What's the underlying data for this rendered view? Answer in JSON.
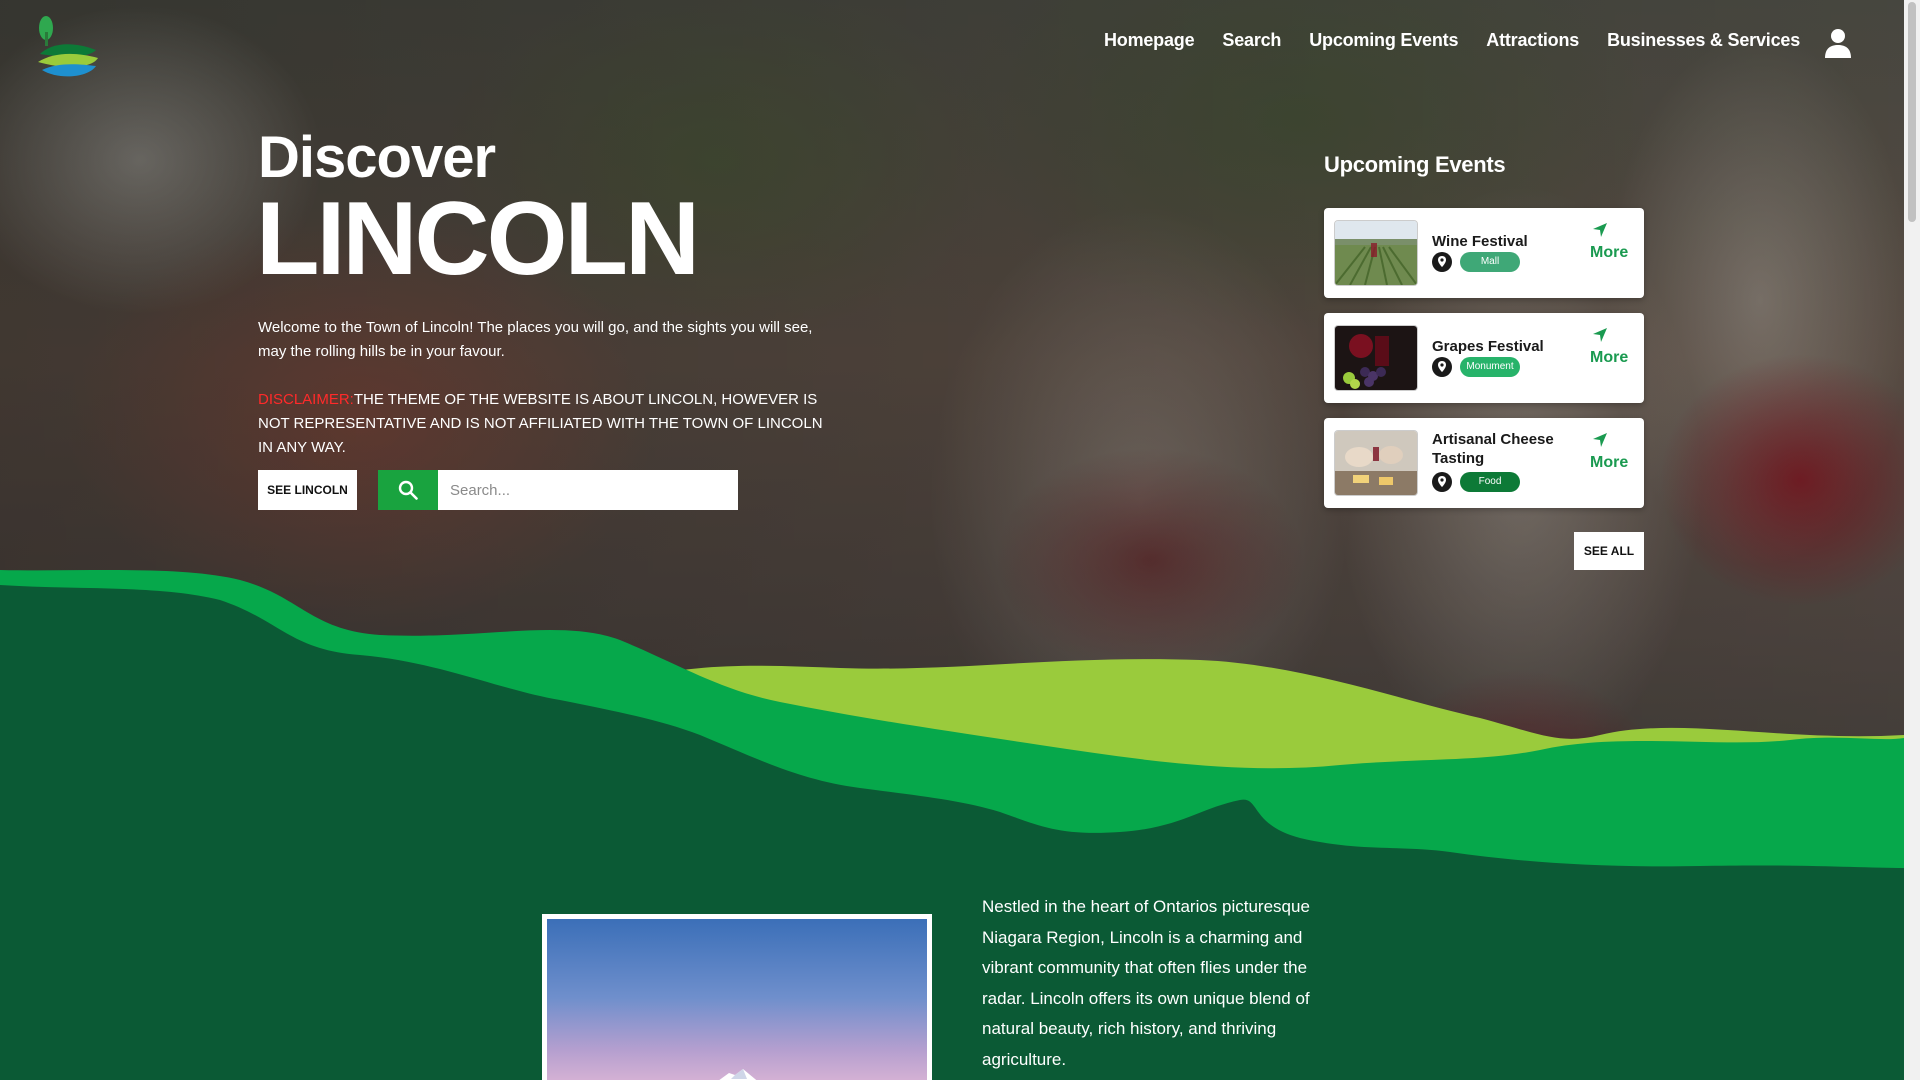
{
  "colors": {
    "dark_green": "#0b5a35",
    "mid_green": "#06a84b",
    "light_green": "#9acb3c",
    "accent_green": "#19a33f",
    "disclaimer_red": "#ff2a2a"
  },
  "header": {
    "logo_icon": "lincoln-hills-logo",
    "nav": [
      "Homepage",
      "Search",
      "Upcoming Events",
      "Attractions",
      "Businesses & Services"
    ],
    "account_icon": "user-icon"
  },
  "hero": {
    "discover": "Discover",
    "title": "LINCOLN",
    "welcome": "Welcome to the Town of Lincoln! The places you will go, and the sights you will see, may the rolling hills be in your favour.",
    "disclaimer_label": "DISCLAIMER:",
    "disclaimer_text": "THE THEME OF THE WEBSITE IS ABOUT LINCOLN, HOWEVER IS NOT REPRESENTATIVE AND IS NOT AFFILIATED WITH THE TOWN OF LINCOLN IN ANY WAY.",
    "see_button": "SEE LINCOLN",
    "search_placeholder": "Search..."
  },
  "events": {
    "title": "Upcoming Events",
    "items": [
      {
        "name": "Wine Festival",
        "tag": "Mall",
        "tag_color": "#3fa877",
        "more": "More"
      },
      {
        "name": "Grapes Festival",
        "tag": "Monument",
        "tag_color": "#27b36a",
        "more": "More"
      },
      {
        "name": "Artisanal Cheese Tasting",
        "tag": "Food",
        "tag_color": "#0d7a37",
        "more": "More"
      }
    ],
    "see_all": "SEE ALL"
  },
  "about": {
    "text": "Nestled in the heart of Ontarios picturesque Niagara Region, Lincoln is a charming and vibrant community that often flies under the radar. Lincoln offers its own unique blend of natural beauty, rich history, and thriving agriculture."
  }
}
